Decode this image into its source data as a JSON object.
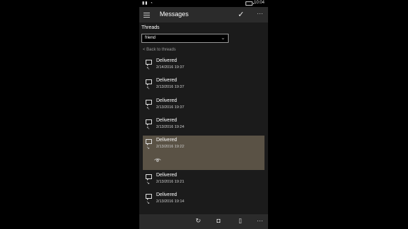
{
  "status_bar": {
    "signal_icons": "signal-wifi-icons",
    "time": "10:04"
  },
  "header": {
    "title": "Messages",
    "more": "···"
  },
  "threads": {
    "label": "Threads",
    "selected": "friend"
  },
  "back_link": "< Back to threads",
  "messages": [
    {
      "status": "Delivered",
      "date": "2/14/2016 19:37",
      "direction": "outgoing",
      "selected": false
    },
    {
      "status": "Delivered",
      "date": "2/13/2016 19:37",
      "direction": "outgoing",
      "selected": false
    },
    {
      "status": "Delivered",
      "date": "2/13/2016 19:37",
      "direction": "outgoing",
      "selected": false
    },
    {
      "status": "Delivered",
      "date": "2/13/2016 19:24",
      "direction": "outgoing",
      "selected": false
    },
    {
      "status": "Delivered",
      "date": "2/13/2016 19:22",
      "direction": "incoming",
      "selected": true
    },
    {
      "status": "Delivered",
      "date": "2/13/2016 19:21",
      "direction": "incoming",
      "selected": false
    },
    {
      "status": "Delivered",
      "date": "2/13/2016 19:14",
      "direction": "incoming",
      "selected": false
    }
  ],
  "bottom_bar": {
    "more": "···"
  },
  "colors": {
    "selected_item": "#5a5245",
    "background": "#1b1b1b",
    "bar": "#2b2b2b"
  }
}
